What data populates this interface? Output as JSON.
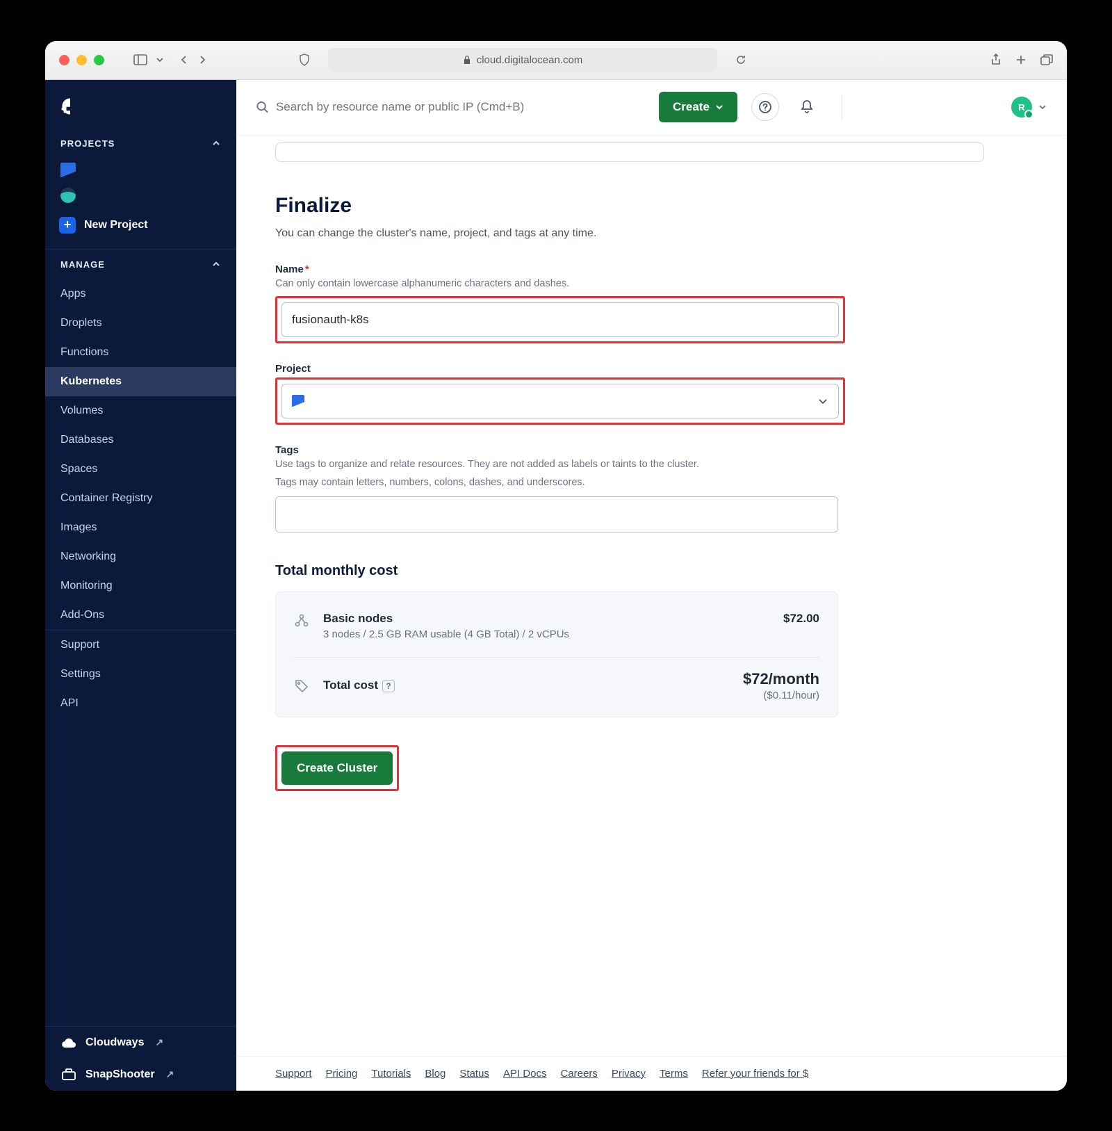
{
  "browser": {
    "url_host": "cloud.digitalocean.com"
  },
  "sidebar": {
    "projects_header": "PROJECTS",
    "new_project": "New Project",
    "manage_header": "MANAGE",
    "items": [
      "Apps",
      "Droplets",
      "Functions",
      "Kubernetes",
      "Volumes",
      "Databases",
      "Spaces",
      "Container Registry",
      "Images",
      "Networking",
      "Monitoring",
      "Add-Ons"
    ],
    "active": "Kubernetes",
    "footer_items": [
      "Support",
      "Settings",
      "API"
    ],
    "external": [
      "Cloudways",
      "SnapShooter"
    ]
  },
  "topbar": {
    "search_placeholder": "Search by resource name or public IP (Cmd+B)",
    "create_label": "Create",
    "avatar_initial": "R"
  },
  "finalize": {
    "title": "Finalize",
    "subtitle": "You can change the cluster's name, project, and tags at any time.",
    "name_label": "Name",
    "name_hint": "Can only contain lowercase alphanumeric characters and dashes.",
    "name_value": "fusionauth-k8s",
    "project_label": "Project",
    "tags_label": "Tags",
    "tags_hint_1": "Use tags to organize and relate resources. They are not added as labels or taints to the cluster.",
    "tags_hint_2": "Tags may contain letters, numbers, colons, dashes, and underscores."
  },
  "cost": {
    "heading": "Total monthly cost",
    "basic_label": "Basic nodes",
    "basic_desc": "3 nodes / 2.5 GB RAM usable (4 GB Total) / 2 vCPUs",
    "basic_price": "$72.00",
    "total_label": "Total cost",
    "total_price": "$72/month",
    "total_hour": "($0.11/hour)"
  },
  "primary_action": "Create Cluster",
  "footer_links": [
    "Support",
    "Pricing",
    "Tutorials",
    "Blog",
    "Status",
    "API Docs",
    "Careers",
    "Privacy",
    "Terms",
    "Refer your friends for $"
  ],
  "colors": {
    "sidebar": "#0b1a3a",
    "accent_green": "#187a3b",
    "highlight_red": "#e72f38",
    "blue": "#2b6de5"
  }
}
